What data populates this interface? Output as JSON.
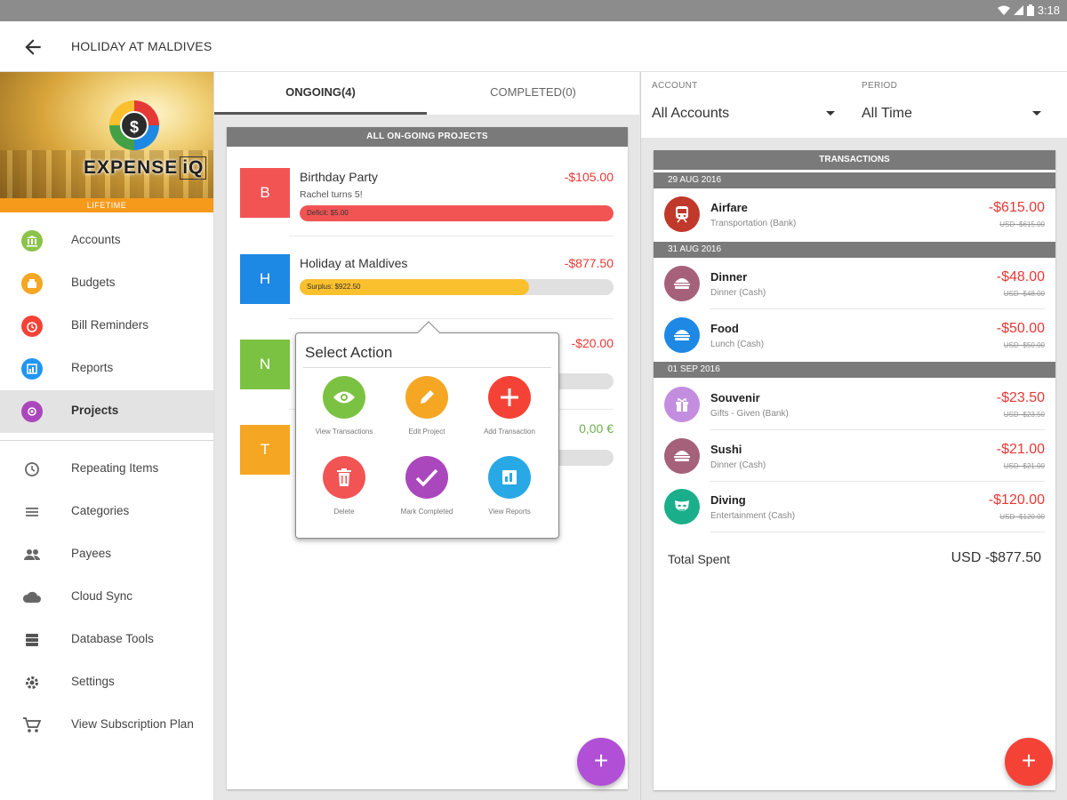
{
  "status_bar": {
    "time": "3:18"
  },
  "app_bar": {
    "title": "HOLIDAY AT MALDIVES"
  },
  "sidebar": {
    "brand": "EXPENSE",
    "brand_suffix": "iQ",
    "banner_badge": "LIFETIME",
    "primary_items": [
      {
        "label": "Accounts",
        "color": "#8bc34a"
      },
      {
        "label": "Budgets",
        "color": "#f5a623"
      },
      {
        "label": "Bill Reminders",
        "color": "#f44336"
      },
      {
        "label": "Reports",
        "color": "#2196f3"
      },
      {
        "label": "Projects",
        "color": "#ab47bc"
      }
    ],
    "secondary_items": [
      {
        "label": "Repeating Items"
      },
      {
        "label": "Categories"
      },
      {
        "label": "Payees"
      },
      {
        "label": "Cloud Sync"
      },
      {
        "label": "Database Tools"
      },
      {
        "label": "Settings"
      },
      {
        "label": "View Subscription Plan"
      }
    ]
  },
  "projects_panel": {
    "tabs": [
      {
        "label": "ONGOING(4)"
      },
      {
        "label": "COMPLETED(0)"
      }
    ],
    "header": "ALL ON-GOING PROJECTS",
    "projects": [
      {
        "letter": "B",
        "name": "Birthday Party",
        "subtitle": "Rachel turns 5!",
        "amount": "-$105.00",
        "bar_label": "Deficit: $5.00",
        "progress": 1.0,
        "color": "#f25454",
        "bar_color": "#f25454"
      },
      {
        "letter": "H",
        "name": "Holiday at Maldives",
        "subtitle": "",
        "amount": "-$877.50",
        "bar_label": "Surplus: $922.50",
        "progress": 0.73,
        "color": "#1e88e5",
        "bar_color": "#fbc02d"
      },
      {
        "letter": "N",
        "name": "",
        "subtitle": "",
        "amount": "-$20.00",
        "bar_label": "",
        "progress": 0,
        "color": "#7cc242",
        "bar_color": "#7cc242"
      },
      {
        "letter": "T",
        "name": "",
        "subtitle": "",
        "amount": "0,00 €",
        "bar_label": "",
        "progress": 0,
        "color": "#f5a623",
        "bar_color": "#f5a623"
      }
    ],
    "popup": {
      "title": "Select Action",
      "actions": [
        {
          "label": "View Transactions",
          "icon": "eye-icon",
          "color": "#7cc242"
        },
        {
          "label": "Edit Project",
          "icon": "pencil-icon",
          "color": "#f5a623"
        },
        {
          "label": "Add Transaction",
          "icon": "plus-icon",
          "color": "#f44336"
        },
        {
          "label": "Delete",
          "icon": "trash-icon",
          "color": "#f25454"
        },
        {
          "label": "Mark Completed",
          "icon": "check-icon",
          "color": "#ab47bc"
        },
        {
          "label": "View Reports",
          "icon": "report-icon",
          "color": "#29a8e6"
        }
      ]
    },
    "fab_symbol": "+",
    "fab_color": "#b14fd6"
  },
  "transactions_panel": {
    "account_label": "ACCOUNT",
    "account_value": "All Accounts",
    "period_label": "PERIOD",
    "period_value": "All Time",
    "header": "TRANSACTIONS",
    "groups": [
      {
        "date": "29 AUG 2016",
        "items": [
          {
            "name": "Airfare",
            "sub": "Transportation (Bank)",
            "amount": "-$615.00",
            "usd": "USD -$615.00",
            "icon": "train-icon",
            "color": "#c0392b"
          }
        ]
      },
      {
        "date": "31 AUG 2016",
        "items": [
          {
            "name": "Dinner",
            "sub": "Dinner (Cash)",
            "amount": "-$48.00",
            "usd": "USD -$48.00",
            "icon": "burger-icon",
            "color": "#a6617a"
          },
          {
            "name": "Food",
            "sub": "Lunch (Cash)",
            "amount": "-$50.00",
            "usd": "USD -$50.00",
            "icon": "burger-icon",
            "color": "#1e88e5"
          }
        ]
      },
      {
        "date": "01 SEP 2016",
        "items": [
          {
            "name": "Souvenir",
            "sub": "Gifts - Given (Bank)",
            "amount": "-$23.50",
            "usd": "USD -$23.50",
            "icon": "gift-icon",
            "color": "#c48ee0"
          },
          {
            "name": "Sushi",
            "sub": "Dinner (Cash)",
            "amount": "-$21.00",
            "usd": "USD -$21.00",
            "icon": "burger-icon",
            "color": "#a6617a"
          },
          {
            "name": "Diving",
            "sub": "Entertainment (Cash)",
            "amount": "-$120.00",
            "usd": "USD -$120.00",
            "icon": "mask-icon",
            "color": "#1aaf8a"
          }
        ]
      }
    ],
    "total_label": "Total Spent",
    "total_value": "USD -$877.50",
    "fab_symbol": "+",
    "fab_color": "#f44336"
  }
}
